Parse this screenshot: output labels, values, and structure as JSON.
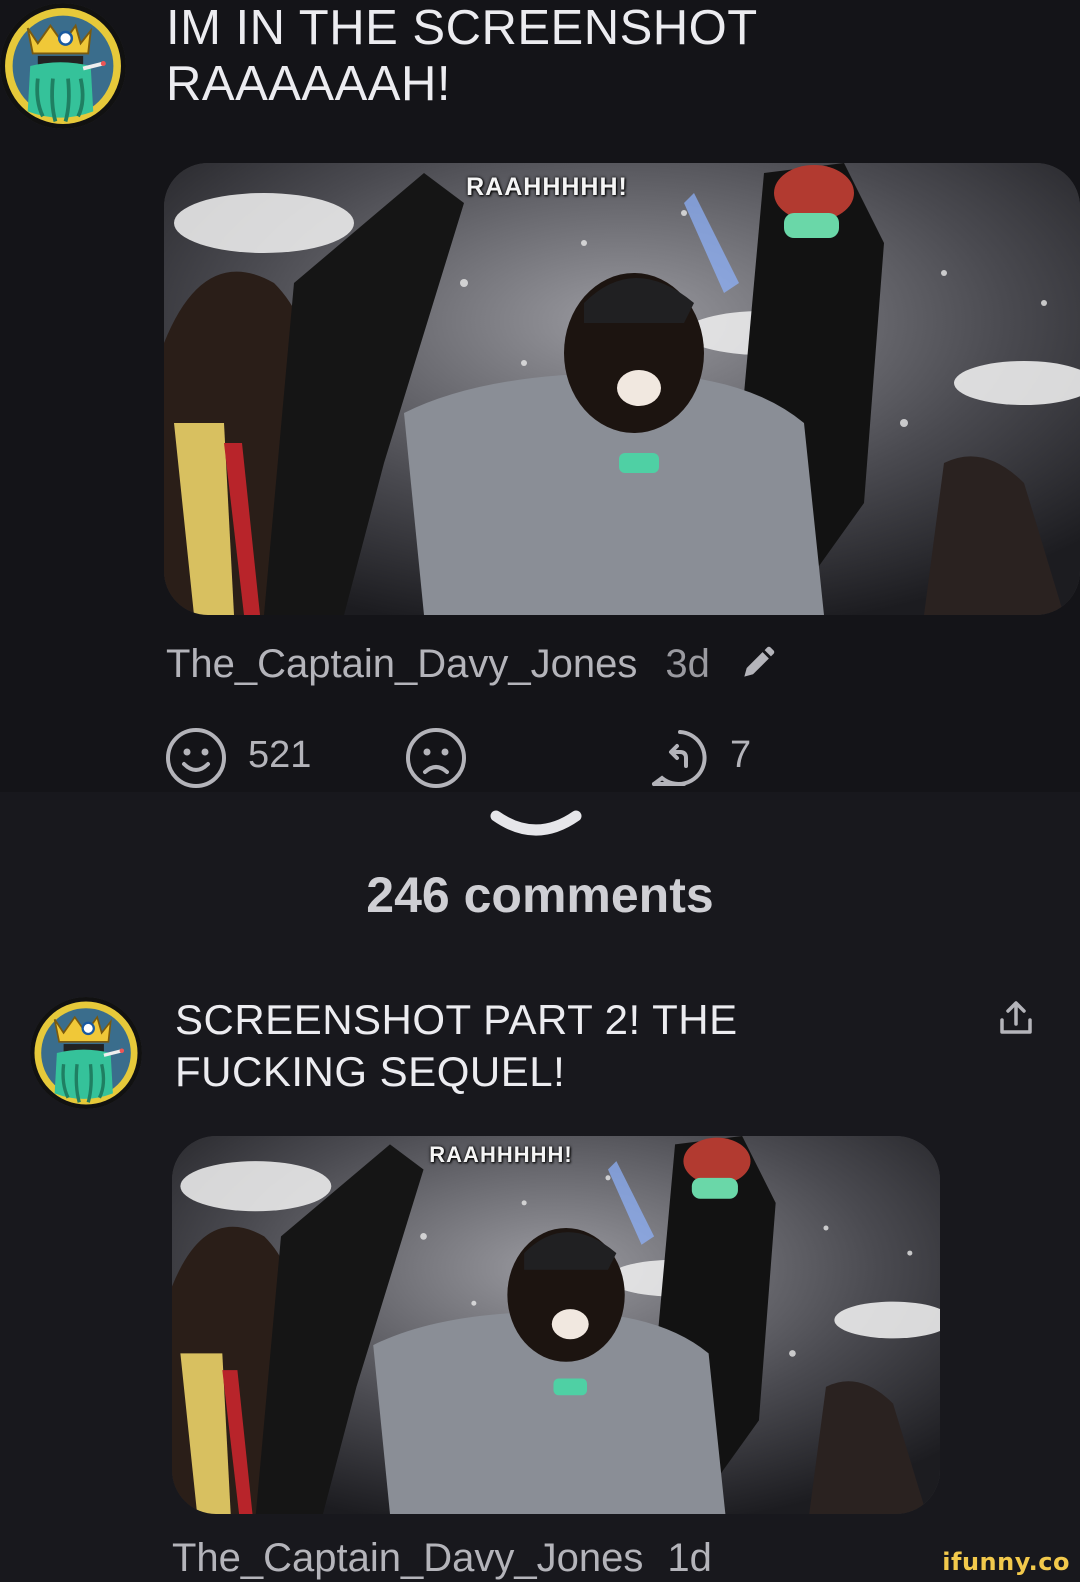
{
  "top_comment": {
    "title": "IM IN THE SCREENSHOT RAAAAAAH!",
    "meme_caption": "RAAHHHHH!",
    "author": "The_Captain_Davy_Jones",
    "time": "3d",
    "smile_count": "521",
    "reply_count": "7"
  },
  "comments_header": {
    "count_label": "246 comments"
  },
  "second_comment": {
    "title": "SCREENSHOT PART 2! THE FUCKING SEQUEL!",
    "meme_caption": "RAAHHHHH!",
    "author": "The_Captain_Davy_Jones",
    "time": "1d"
  },
  "watermark": "ifunny.co",
  "icons": {
    "edit": "pencil-icon",
    "smile": "smile-icon",
    "unsmile": "frown-icon",
    "reply": "reply-icon",
    "share": "share-icon",
    "collapse": "chevron-down-icon"
  },
  "colors": {
    "background": "#18181d",
    "text": "#ececf0",
    "muted": "#b4b4ba",
    "watermark": "#f2c94c"
  }
}
